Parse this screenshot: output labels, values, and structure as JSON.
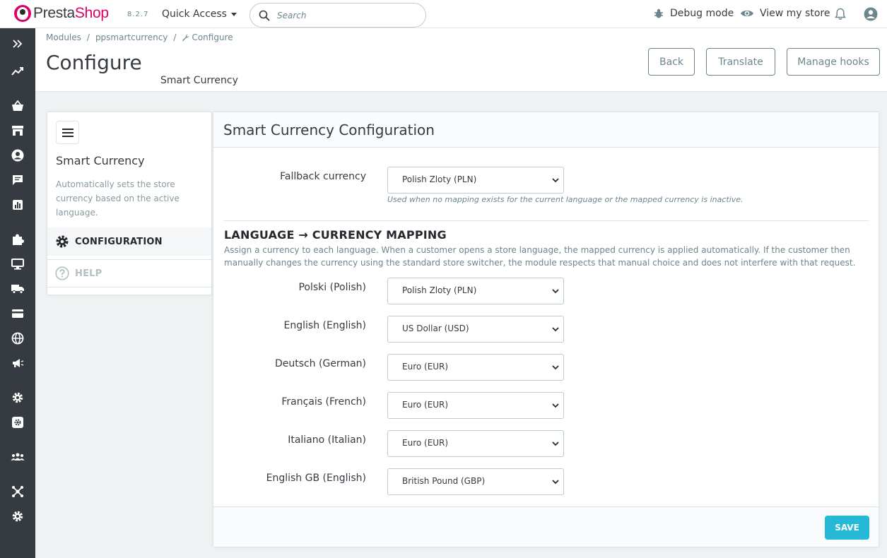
{
  "header": {
    "logo_main": "Presta",
    "logo_accent": "Shop",
    "version": "8.2.7",
    "quick_access": "Quick Access",
    "search_placeholder": "Search",
    "debug_mode": "Debug mode",
    "view_store": "View my store"
  },
  "sidebar": {
    "icons": [
      "expand-icon",
      "dashboard-icon",
      "orders-icon",
      "catalog-icon",
      "customers-icon",
      "messages-icon",
      "stats-icon",
      "modules-icon",
      "design-icon",
      "shipping-icon",
      "payment-icon",
      "international-icon",
      "marketing-icon",
      "settings-icon",
      "advanced-icon",
      "team-icon",
      "network-icon",
      "configure-icon"
    ]
  },
  "breadcrumb": {
    "items": [
      "Modules",
      "ppsmartcurrency",
      "Configure"
    ]
  },
  "page": {
    "title": "Configure",
    "subtitle": "Smart Currency",
    "buttons": {
      "back": "Back",
      "translate": "Translate",
      "manage_hooks": "Manage hooks"
    }
  },
  "module_panel": {
    "name": "Smart Currency",
    "description": "Automatically sets the store currency based on the active language.",
    "tabs": {
      "configuration": "CONFIGURATION",
      "help": "HELP"
    }
  },
  "config": {
    "title": "Smart Currency Configuration",
    "fallback": {
      "label": "Fallback currency",
      "value": "Polish Zloty (PLN)",
      "help": "Used when no mapping exists for the current language or the mapped currency is inactive."
    },
    "mapping_title": "LANGUAGE → CURRENCY MAPPING",
    "mapping_desc": "Assign a currency to each language. When a customer opens a store language, the mapped currency is applied automatically. If the customer then manually changes the currency using the standard store switcher, the module respects that manual choice and does not interfere with that request.",
    "mappings": [
      {
        "language": "Polski (Polish)",
        "currency": "Polish Zloty (PLN)"
      },
      {
        "language": "English (English)",
        "currency": "US Dollar (USD)"
      },
      {
        "language": "Deutsch (German)",
        "currency": "Euro (EUR)"
      },
      {
        "language": "Français (French)",
        "currency": "Euro (EUR)"
      },
      {
        "language": "Italiano (Italian)",
        "currency": "Euro (EUR)"
      },
      {
        "language": "English GB (English)",
        "currency": "British Pound (GBP)"
      }
    ],
    "save": "SAVE"
  },
  "colors": {
    "brand": "#df0067",
    "sidebar": "#363a41",
    "primary": "#25b9d7"
  }
}
